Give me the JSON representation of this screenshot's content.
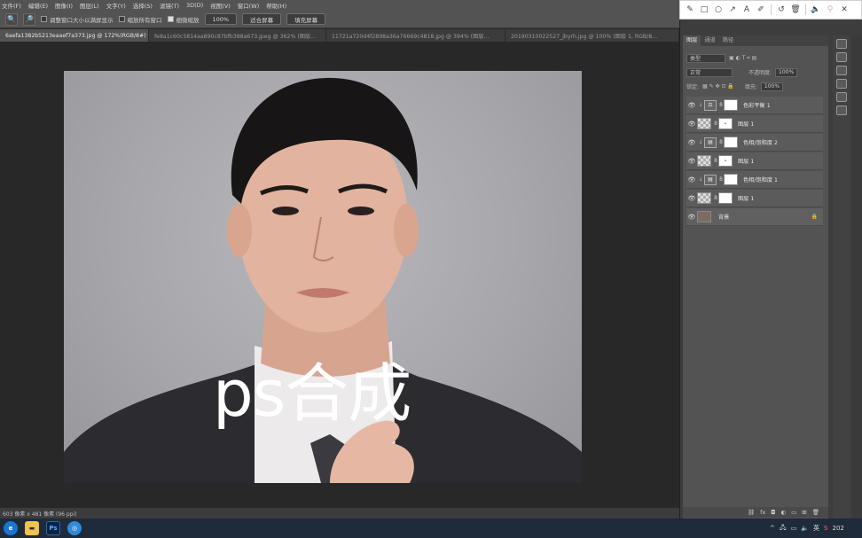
{
  "menubar": {
    "items": [
      "文件(F)",
      "编辑(E)",
      "图像(I)",
      "图层(L)",
      "文字(Y)",
      "选择(S)",
      "滤镜(T)",
      "3D(D)",
      "视图(V)",
      "窗口(W)",
      "帮助(H)"
    ]
  },
  "annotation_toolbar": {
    "icons": [
      "pen-icon",
      "rectangle-icon",
      "circle-icon",
      "arrow-icon",
      "text-icon",
      "marker-icon",
      "undo-icon",
      "delete-icon",
      "volume-icon",
      "pin-icon",
      "close-icon"
    ]
  },
  "options": {
    "resize_window": "调整窗口大小以满屏显示",
    "zoom_all": "缩放所有窗口",
    "scrubby_zoom": "细微缩放",
    "zoom_value": "100%",
    "fit_screen": "适合屏幕",
    "fill_screen": "填充屏幕"
  },
  "doc_tabs": [
    {
      "label": "6aefa1382b5213eaaef7a373.jpg @ 172%(RGB/8#) *",
      "active": true
    },
    {
      "label": "fe8a1c60c5814aa890c87bfb388a673.jpeg @ 362% (图层...",
      "active": false
    },
    {
      "label": "11721a720d4f2898a36a76669c4818.jpg @ 394% (图层...",
      "active": false
    },
    {
      "label": "20190310022527_jbyrh.jpg @ 100% (图层 1, RGB/8...",
      "active": false
    }
  ],
  "overlay_text": "ps合成",
  "status": {
    "dimensions": "603 像素 x 481 像素 (96 ppi)"
  },
  "layers_panel": {
    "tabs": [
      "图层",
      "通道",
      "路径"
    ],
    "filter_kind": "类型",
    "blend_mode": "正常",
    "opacity_label": "不透明度:",
    "opacity_value": "100%",
    "lock_label": "锁定:",
    "fill_label": "填充:",
    "fill_value": "100%",
    "layers": [
      {
        "name": "色彩平衡 1",
        "kind": "adjustment",
        "adj_icon": "color-balance-icon"
      },
      {
        "name": "图层 1",
        "kind": "pixel"
      },
      {
        "name": "色相/饱和度 2",
        "kind": "adjustment",
        "adj_icon": "hue-saturation-icon"
      },
      {
        "name": "图层 1",
        "kind": "pixel"
      },
      {
        "name": "色相/饱和度 1",
        "kind": "adjustment",
        "adj_icon": "hue-saturation-icon"
      },
      {
        "name": "图层 1",
        "kind": "pixel"
      },
      {
        "name": "背景",
        "kind": "background"
      }
    ]
  },
  "taskbar": {
    "apps": [
      "edge-icon",
      "file-explorer-icon",
      "photoshop-icon",
      "browser-icon"
    ],
    "ps_label": "Ps",
    "clock_partial": "202"
  }
}
